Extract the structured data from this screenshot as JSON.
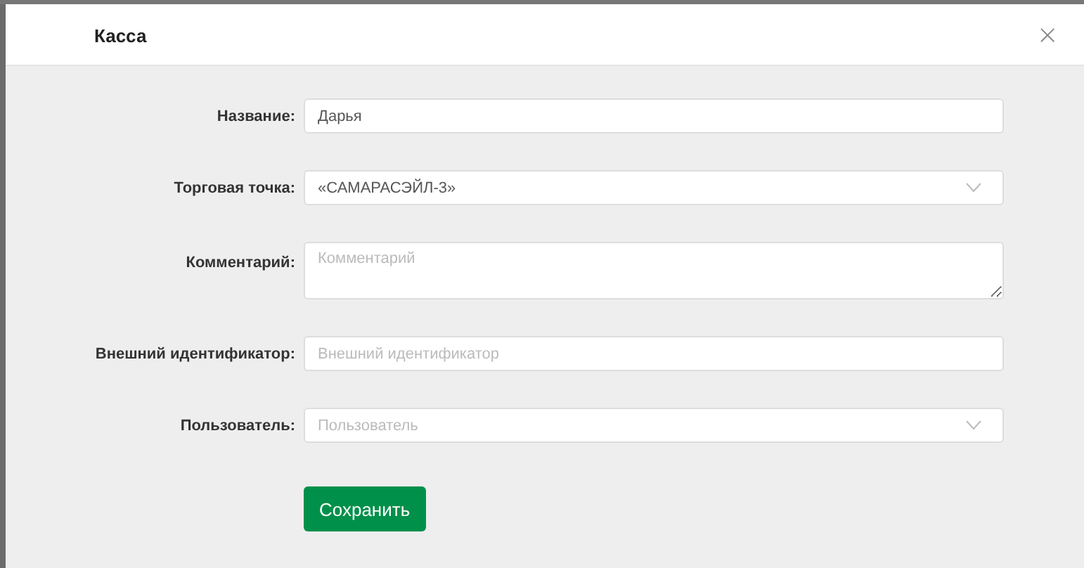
{
  "dialog": {
    "title": "Касса",
    "close": "×"
  },
  "fields": [
    {
      "kind": "input",
      "label": "Название:",
      "value": "Дарья"
    },
    {
      "kind": "select",
      "label": "Торговая точка:",
      "value": "«САМАРАСЭЙЛ-3»"
    },
    {
      "kind": "textarea",
      "label": "Комментарий:",
      "placeholder": "Комментарий"
    },
    {
      "kind": "input",
      "label": "Внешний идентификатор:",
      "placeholder": "Внешний идентификатор"
    },
    {
      "kind": "select",
      "label": "Пользователь:",
      "placeholder": "Пользователь"
    }
  ],
  "save_button": "Сохранить"
}
